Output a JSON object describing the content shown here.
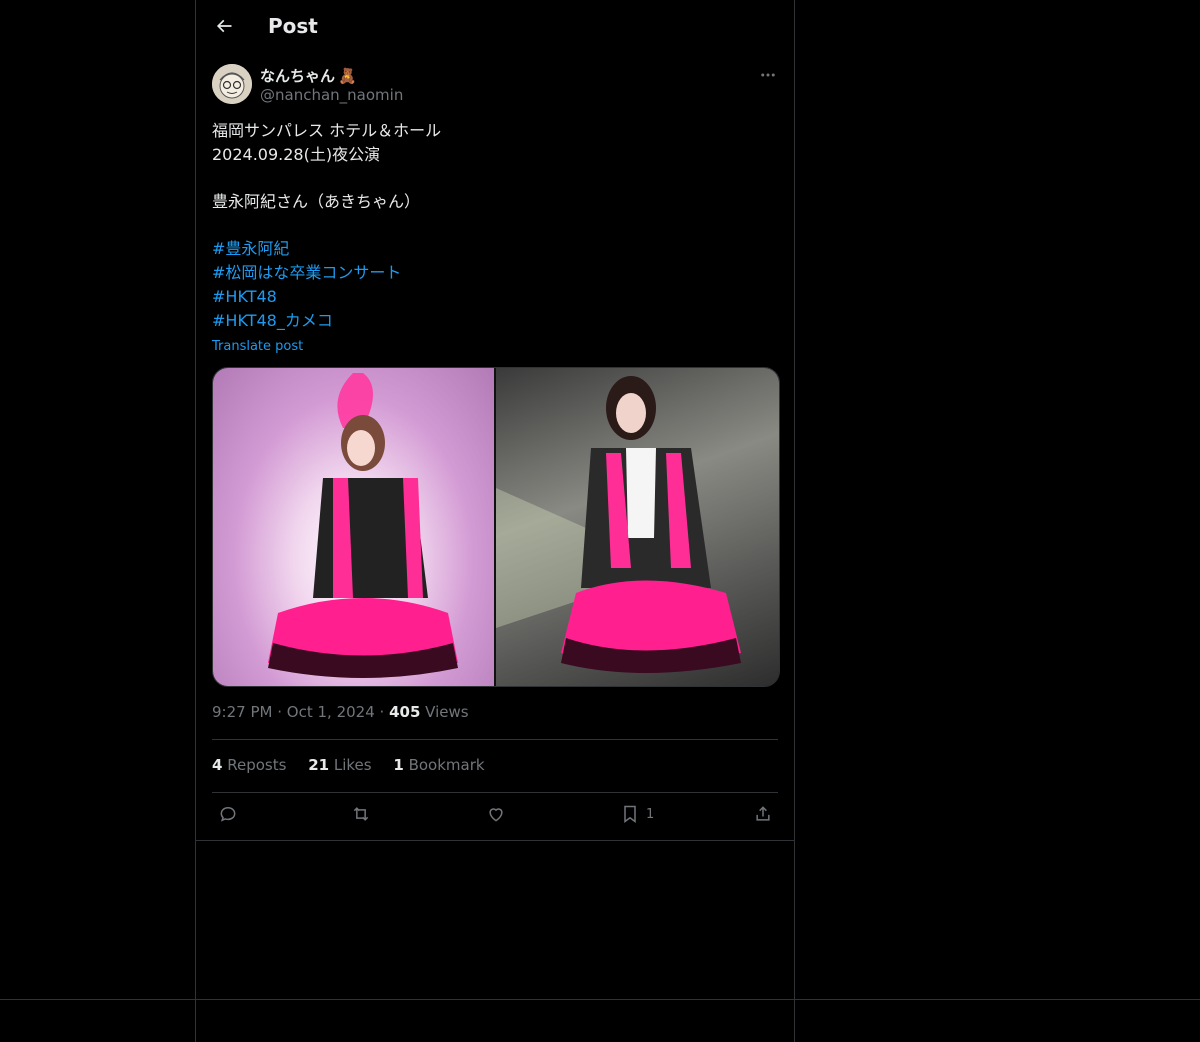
{
  "header": {
    "title": "Post"
  },
  "author": {
    "name": "なんちゃん",
    "emoji": "🧸",
    "handle": "@nanchan_naomin"
  },
  "post": {
    "lines": [
      "福岡サンパレス ホテル＆ホール",
      "2024.09.28(土)夜公演",
      "豊永阿紀さん（あきちゃん）"
    ],
    "hashtags": [
      "#豊永阿紀",
      "#松岡はな卒業コンサート",
      "#HKT48",
      "#HKT48_カメコ"
    ],
    "translate_label": "Translate post"
  },
  "meta": {
    "time": "9:27 PM",
    "date": "Oct 1, 2024",
    "views_count": "405",
    "views_label": "Views"
  },
  "stats": {
    "reposts_count": "4",
    "reposts_label": "Reposts",
    "likes_count": "21",
    "likes_label": "Likes",
    "bookmarks_count": "1",
    "bookmarks_label": "Bookmark"
  },
  "actions": {
    "bookmark_count": "1"
  },
  "icons": [
    "back-arrow-icon",
    "more-icon",
    "reply-icon",
    "repost-icon",
    "like-icon",
    "bookmark-icon",
    "share-icon"
  ],
  "colors": {
    "background": "#000000",
    "text": "#e7e9ea",
    "muted": "#71767b",
    "link": "#1d9bf0",
    "border": "#2f3336"
  }
}
